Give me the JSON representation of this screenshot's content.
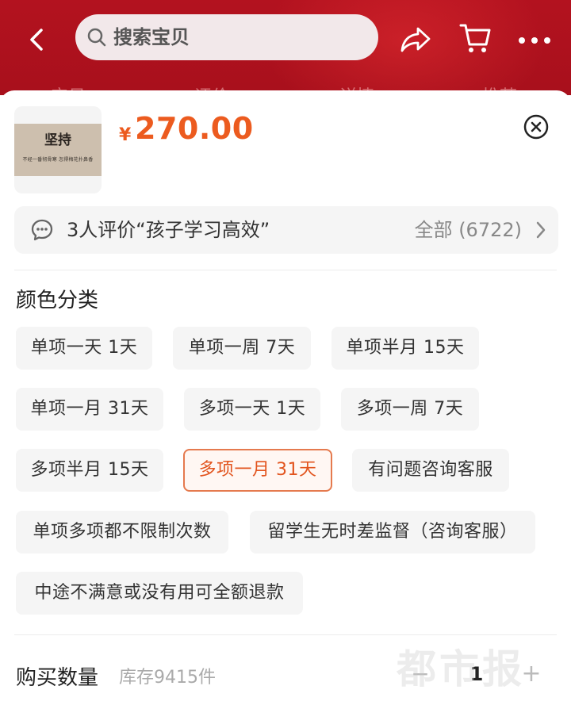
{
  "header": {
    "search_placeholder": "搜索宝贝",
    "tabs": [
      "宝贝",
      "评价",
      "详情",
      "推荐"
    ]
  },
  "product": {
    "thumb_title": "坚持",
    "thumb_subtitle": "不经一番彻骨寒 怎得梅花扑鼻香",
    "price_symbol": "¥",
    "price": "270.00"
  },
  "review": {
    "text": "3人评价“孩子学习高效”",
    "count": "全部 (6722)"
  },
  "options": {
    "title": "颜色分类",
    "items": [
      "单项一天 1天",
      "单项一周 7天",
      "单项半月 15天",
      "单项一月 31天",
      "多项一天 1天",
      "多项一周 7天",
      "多项半月 15天",
      "多项一月 31天",
      "有问题咨询客服",
      "单项多项都不限制次数",
      "留学生无时差监督（咨询客服）",
      "中途不满意或没有用可全额退款"
    ],
    "selected_index": 7
  },
  "quantity": {
    "label": "购买数量",
    "stock": "库存9415件",
    "value": "1",
    "minus": "−",
    "plus": "+"
  },
  "watermark": "都市报",
  "colors": {
    "header_red": "#b3121f",
    "price_orange": "#ec5b1f",
    "selected_border": "#e57a4e"
  }
}
